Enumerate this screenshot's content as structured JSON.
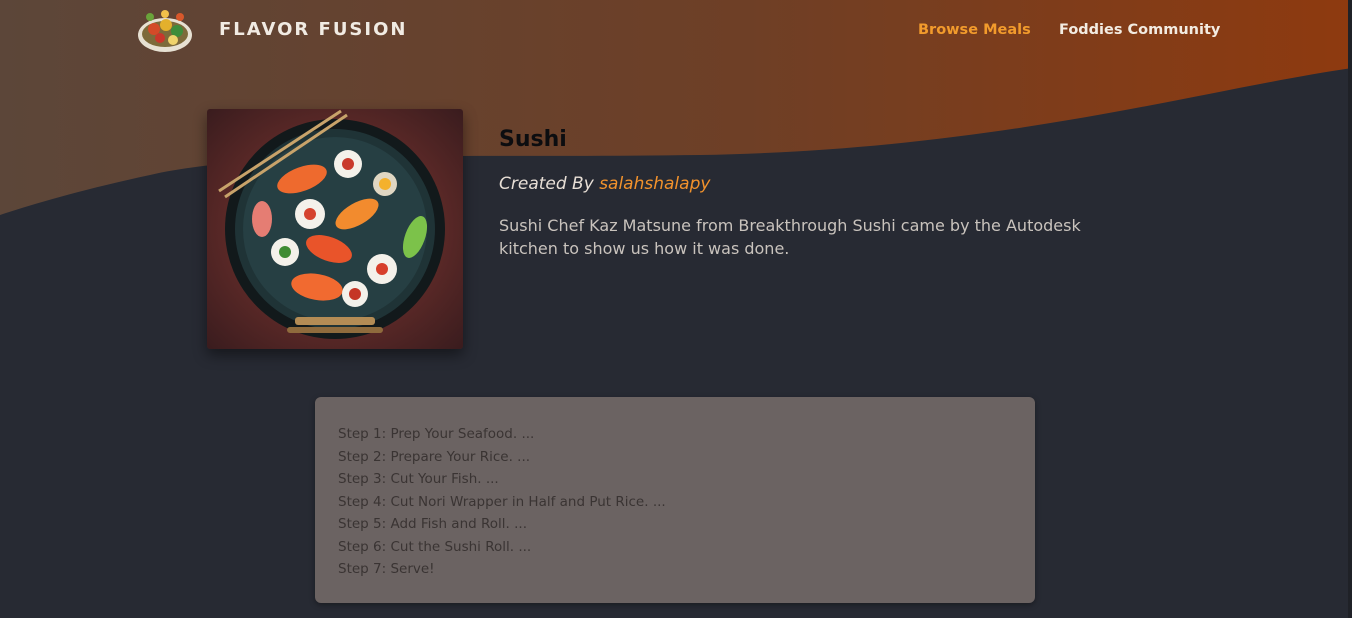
{
  "header": {
    "brand": "FLAVOR FUSION",
    "nav": [
      {
        "label": "Browse Meals",
        "active": true
      },
      {
        "label": "Foddies Community",
        "active": false
      }
    ]
  },
  "meal": {
    "title": "Sushi",
    "created_by_prefix": "Created By",
    "author": "salahshalapy",
    "description": "Sushi Chef Kaz Matsune from Breakthrough Sushi came by the Autodesk kitchen to show us how it was done."
  },
  "steps": [
    "Step 1: Prep Your Seafood. ...",
    "Step 2: Prepare Your Rice. ...",
    "Step 3: Cut Your Fish. ...",
    "Step 4: Cut Nori Wrapper in Half and Put Rice. ...",
    "Step 5: Add Fish and Roll. ...",
    "Step 6: Cut the Sushi Roll. ...",
    "Step 7: Serve!"
  ],
  "colors": {
    "accent": "#f2922c",
    "background": "#272a33",
    "card": "#6b6362",
    "hero_gradient_start": "#5c4639",
    "hero_gradient_end": "#8e3a0f"
  }
}
